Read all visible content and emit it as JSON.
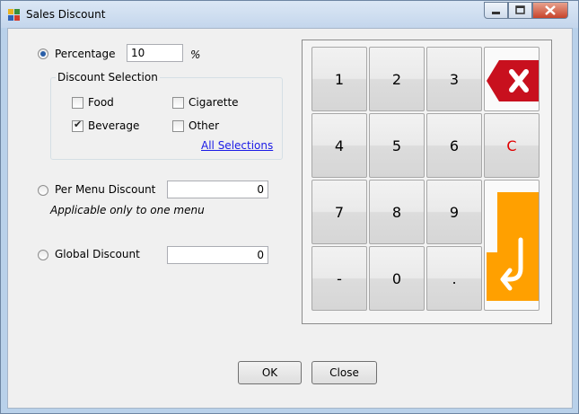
{
  "window": {
    "title": "Sales Discount"
  },
  "options": {
    "percentage": {
      "label": "Percentage",
      "value": "10",
      "unit": "%",
      "selected": true
    },
    "per_menu": {
      "label": "Per Menu Discount",
      "value": "0",
      "note": "Applicable only to one menu",
      "selected": false
    },
    "global": {
      "label": "Global Discount",
      "value": "0",
      "selected": false
    }
  },
  "discount_selection": {
    "title": "Discount Selection",
    "items": [
      {
        "label": "Food",
        "checked": false
      },
      {
        "label": "Cigarette",
        "checked": false
      },
      {
        "label": "Beverage",
        "checked": true
      },
      {
        "label": "Other",
        "checked": false
      }
    ],
    "all_link": "All Selections"
  },
  "keypad": {
    "keys": [
      "1",
      "2",
      "3",
      "4",
      "5",
      "6",
      "7",
      "8",
      "9",
      "-",
      "0",
      "."
    ],
    "clear_label": "C",
    "clear_color": "#e00000",
    "delete_icon": "backspace-x-icon",
    "enter_icon": "enter-return-icon",
    "enter_color": "#ffa000",
    "delete_color": "#c8101e"
  },
  "buttons": {
    "ok": "OK",
    "close": "Close"
  }
}
